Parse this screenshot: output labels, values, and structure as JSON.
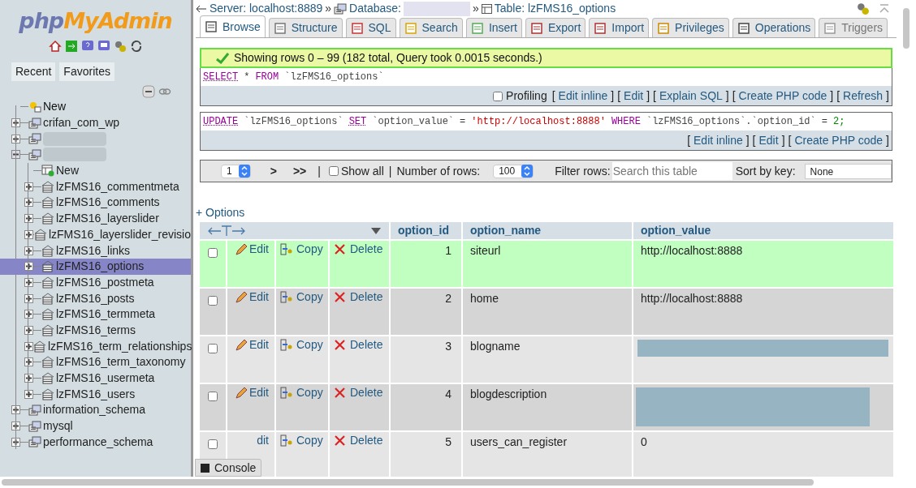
{
  "sidebar": {
    "logo": {
      "first": "php",
      "second": "MyAdmin"
    },
    "tabs": [
      "Recent",
      "Favorites"
    ],
    "tree": [
      {
        "kind": "new",
        "label": "New"
      },
      {
        "kind": "database",
        "label": "crifan_com_wp",
        "expanded": false
      },
      {
        "kind": "database",
        "redacted": true,
        "expanded": false
      },
      {
        "kind": "database",
        "redacted": true,
        "expanded": true,
        "children": [
          {
            "kind": "new-table",
            "label": "New"
          },
          {
            "kind": "table",
            "label": "lzFMS16_commentmeta",
            "selected": false
          },
          {
            "kind": "table",
            "label": "lzFMS16_comments",
            "selected": false
          },
          {
            "kind": "table",
            "label": "lzFMS16_layerslider",
            "selected": false
          },
          {
            "kind": "table",
            "label": "lzFMS16_layerslider_revisio",
            "selected": false
          },
          {
            "kind": "table",
            "label": "lzFMS16_links",
            "selected": false
          },
          {
            "kind": "table",
            "label": "lzFMS16_options",
            "selected": true
          },
          {
            "kind": "table",
            "label": "lzFMS16_postmeta",
            "selected": false
          },
          {
            "kind": "table",
            "label": "lzFMS16_posts",
            "selected": false
          },
          {
            "kind": "table",
            "label": "lzFMS16_termmeta",
            "selected": false
          },
          {
            "kind": "table",
            "label": "lzFMS16_terms",
            "selected": false
          },
          {
            "kind": "table",
            "label": "lzFMS16_term_relationships",
            "selected": false
          },
          {
            "kind": "table",
            "label": "lzFMS16_term_taxonomy",
            "selected": false
          },
          {
            "kind": "table",
            "label": "lzFMS16_usermeta",
            "selected": false
          },
          {
            "kind": "table",
            "label": "lzFMS16_users",
            "selected": false
          }
        ]
      },
      {
        "kind": "database",
        "label": "information_schema",
        "expanded": false
      },
      {
        "kind": "database",
        "label": "mysql",
        "expanded": false
      },
      {
        "kind": "database",
        "label": "performance_schema",
        "expanded": false
      }
    ]
  },
  "breadcrumb": {
    "server": "Server: localhost:8889",
    "sep": "»",
    "database": "Database:",
    "table": "Table: lzFMS16_options"
  },
  "tabs": [
    {
      "label": "Browse",
      "selected": true
    },
    {
      "label": "Structure",
      "selected": false
    },
    {
      "label": "SQL",
      "selected": false
    },
    {
      "label": "Search",
      "selected": false
    },
    {
      "label": "Insert",
      "selected": false
    },
    {
      "label": "Export",
      "selected": false
    },
    {
      "label": "Import",
      "selected": false
    },
    {
      "label": "Privileges",
      "selected": false
    },
    {
      "label": "Operations",
      "selected": false
    },
    {
      "label": "Triggers",
      "selected": false,
      "disabled": true
    }
  ],
  "message": "Showing rows 0 – 99 (182 total, Query took 0.0015 seconds.)",
  "select_query": [
    {
      "kind": "link",
      "text": "SELECT"
    },
    {
      "kind": "plain",
      "text": "*"
    },
    {
      "kind": "keyword",
      "text": "FROM"
    },
    {
      "kind": "name",
      "text": "`lzFMS16_options`"
    }
  ],
  "select_tools": {
    "profiling": {
      "label": "Profiling",
      "checked": false
    },
    "open": "[",
    "close": "]",
    "links": [
      "Edit inline",
      "Edit",
      "Explain SQL",
      "Create PHP code",
      "Refresh"
    ]
  },
  "update_query": [
    {
      "kind": "link",
      "text": "UPDATE"
    },
    {
      "kind": "name",
      "text": "`lzFMS16_options`"
    },
    {
      "kind": "link",
      "text": "SET"
    },
    {
      "kind": "name",
      "text": "`option_value`"
    },
    {
      "kind": "plain",
      "text": "="
    },
    {
      "kind": "string",
      "text": "'http://localhost:8888'"
    },
    {
      "kind": "keyword",
      "text": "WHERE"
    },
    {
      "kind": "name",
      "text": "`lzFMS16_options`.`option_id`"
    },
    {
      "kind": "plain",
      "text": "="
    },
    {
      "kind": "number",
      "text": "2;"
    }
  ],
  "update_tools": {
    "open": "[",
    "close": "]",
    "links": [
      "Edit inline",
      "Edit",
      "Create PHP code"
    ]
  },
  "navigation": {
    "page": "1",
    "next": ">",
    "last": ">>",
    "sep": "|",
    "show_all": {
      "label": "Show all",
      "checked": false
    },
    "rows_label": "Number of rows:",
    "rows_value": "100",
    "filter_label": "Filter rows:",
    "filter_placeholder": "Search this table",
    "sort_label": "Sort by key:",
    "sort_value": "None"
  },
  "options_link": "+ Options",
  "table": {
    "columns": [
      "option_id",
      "option_name",
      "option_value"
    ],
    "rows": [
      {
        "checked": false,
        "highlighted": true,
        "edit": "Edit",
        "edit_icon": true,
        "copy": "Copy",
        "delete": "Delete",
        "option_id": "1",
        "option_name": "siteurl",
        "option_value": "http://localhost:8888"
      },
      {
        "checked": false,
        "highlighted": false,
        "edit": "Edit",
        "edit_icon": true,
        "copy": "Copy",
        "delete": "Delete",
        "option_id": "2",
        "option_name": "home",
        "option_value": "http://localhost:8888"
      },
      {
        "checked": false,
        "highlighted": false,
        "edit": "Edit",
        "edit_icon": true,
        "copy": "Copy",
        "delete": "Delete",
        "option_id": "3",
        "option_name": "blogname",
        "value_redacted": true
      },
      {
        "checked": false,
        "highlighted": false,
        "edit": "Edit",
        "edit_icon": true,
        "copy": "Copy",
        "delete": "Delete",
        "option_id": "4",
        "option_name": "blogdescription",
        "value_redacted": true
      },
      {
        "checked": false,
        "highlighted": false,
        "edit": "dit",
        "edit_icon": false,
        "copy": "Copy",
        "delete": "Delete",
        "option_id": "5",
        "option_name": "users_can_register",
        "option_value": "0"
      }
    ]
  },
  "console": "Console"
}
